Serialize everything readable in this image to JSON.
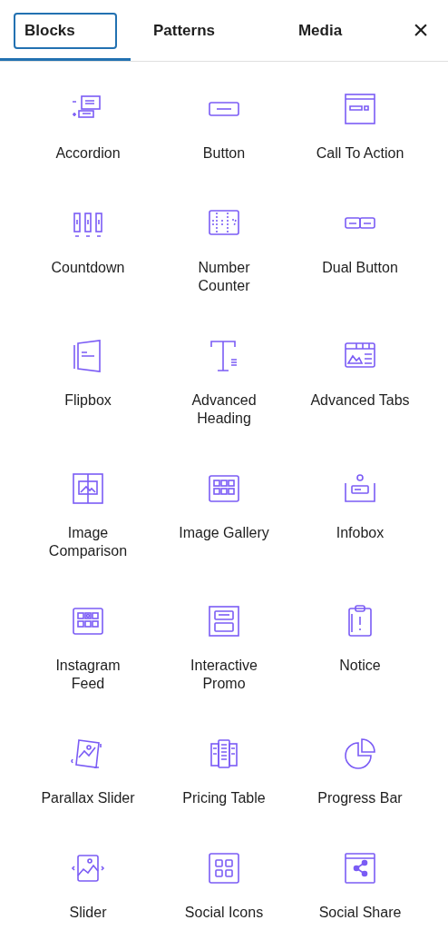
{
  "tabs": [
    {
      "label": "Blocks",
      "selected": true
    },
    {
      "label": "Patterns",
      "selected": false
    },
    {
      "label": "Media",
      "selected": false
    }
  ],
  "close": "×",
  "blocks": [
    {
      "label": "Accordion"
    },
    {
      "label": "Button"
    },
    {
      "label": "Call To Action"
    },
    {
      "label": "Countdown"
    },
    {
      "label": "Number Counter"
    },
    {
      "label": "Dual Button"
    },
    {
      "label": "Flipbox"
    },
    {
      "label": "Advanced Heading"
    },
    {
      "label": "Advanced Tabs"
    },
    {
      "label": "Image Comparison"
    },
    {
      "label": "Image Gallery"
    },
    {
      "label": "Infobox"
    },
    {
      "label": "Instagram Feed"
    },
    {
      "label": "Interactive Promo"
    },
    {
      "label": "Notice"
    },
    {
      "label": "Parallax Slider"
    },
    {
      "label": "Pricing Table"
    },
    {
      "label": "Progress Bar"
    },
    {
      "label": "Slider"
    },
    {
      "label": "Social Icons"
    },
    {
      "label": "Social Share"
    }
  ]
}
